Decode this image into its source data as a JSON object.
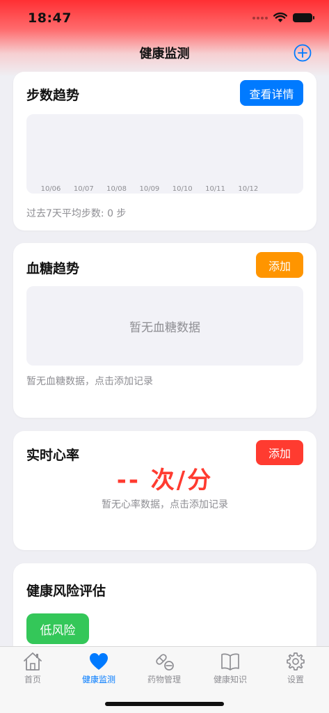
{
  "status": {
    "time": "18:47"
  },
  "nav": {
    "title": "健康监测"
  },
  "steps_card": {
    "title": "步数趋势",
    "button": "查看详情",
    "note": "过去7天平均步数: 0 步",
    "dates": [
      "10/06",
      "10/07",
      "10/08",
      "10/09",
      "10/10",
      "10/11",
      "10/12"
    ]
  },
  "glucose_card": {
    "title": "血糖趋势",
    "button": "添加",
    "empty": "暂无血糖数据",
    "note": "暂无血糖数据，点击添加记录"
  },
  "heart_card": {
    "title": "实时心率",
    "button": "添加",
    "value": "-- 次/分",
    "note": "暂无心率数据，点击添加记录"
  },
  "risk_card": {
    "title": "健康风险评估",
    "level": "低风险"
  },
  "tabs": [
    {
      "label": "首页",
      "icon": "home-icon",
      "active": false
    },
    {
      "label": "健康监测",
      "icon": "heart-icon",
      "active": true
    },
    {
      "label": "药物管理",
      "icon": "pills-icon",
      "active": false
    },
    {
      "label": "健康知识",
      "icon": "book-icon",
      "active": false
    },
    {
      "label": "设置",
      "icon": "gear-icon",
      "active": false
    }
  ],
  "colors": {
    "accent": "#007aff",
    "orange": "#ff9500",
    "red": "#ff3b30",
    "green": "#34c759"
  }
}
